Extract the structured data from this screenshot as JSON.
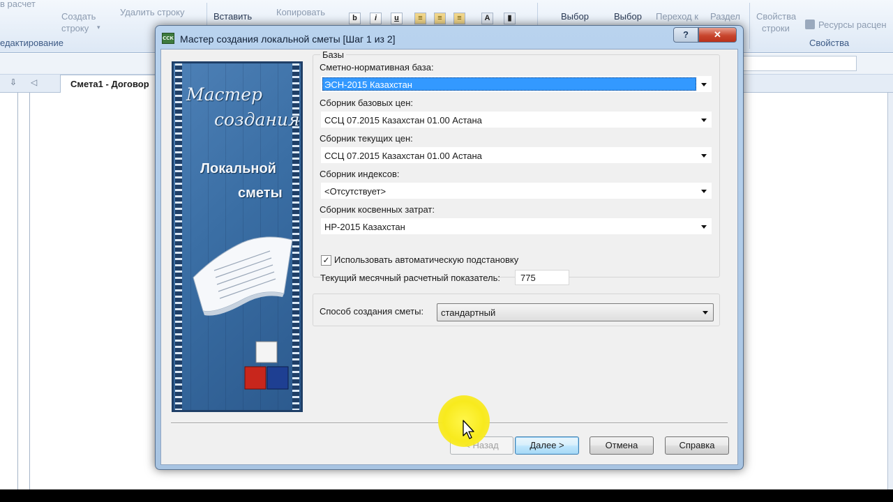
{
  "app": {
    "ribbon": {
      "items": {
        "calc": "в расчет",
        "create_row_1": "Создать",
        "create_row_2": "строку",
        "delete_row": "Удалить строку",
        "insert": "Вставить",
        "copy": "Копировать",
        "select_1": "Выбор",
        "select_2": "Выбор",
        "goto": "Переход к",
        "section": "Раздел",
        "row_props_1": "Свойства",
        "row_props_2": "строки",
        "resources": "Ресурсы расцен"
      },
      "format_buttons": [
        "b",
        "i",
        "u"
      ],
      "groups": {
        "editing": "едактирование",
        "properties": "Свойства"
      }
    },
    "tab_title": "Смета1 - Договор"
  },
  "dialog": {
    "title": "Мастер создания локальной сметы [Шаг 1 из 2]",
    "help_label": "?",
    "close_label": "✕",
    "icon_text": "ССК",
    "banner": {
      "line1": "Мастер",
      "line2": "создания",
      "line3": "Локальной",
      "line4": "сметы"
    },
    "bases_group": "Базы",
    "fields": {
      "norm_base": {
        "label": "Сметно-нормативная база:",
        "value": "ЭСН-2015 Казахстан"
      },
      "base_prices": {
        "label": "Сборник базовых цен:",
        "value": "ССЦ 07.2015 Казахстан 01.00 Астана"
      },
      "current_prices": {
        "label": "Сборник текущих цен:",
        "value": "ССЦ 07.2015 Казахстан 01.00 Астана"
      },
      "indexes": {
        "label": "Сборник индексов:",
        "value": "<Отсутствует>"
      },
      "indirect_costs": {
        "label": "Сборник косвенных затрат:",
        "value": "НР-2015 Казахстан"
      }
    },
    "auto_substitution": {
      "label": "Использовать автоматическую подстановку",
      "checked": true,
      "mark": "✓"
    },
    "mrp": {
      "label": "Текущий месячный расчетный показатель:",
      "value": "775"
    },
    "method": {
      "label": "Способ создания сметы:",
      "value": "стандартный"
    },
    "buttons": {
      "back": "< Назад",
      "next": "Далее >",
      "cancel": "Отмена",
      "help": "Справка"
    }
  },
  "colors": {
    "selection": "#3399ff",
    "dialog_frame": "#b9d3ee",
    "banner_blue": "#3a6ea4",
    "cursor_highlight": "#f8ea1d"
  }
}
